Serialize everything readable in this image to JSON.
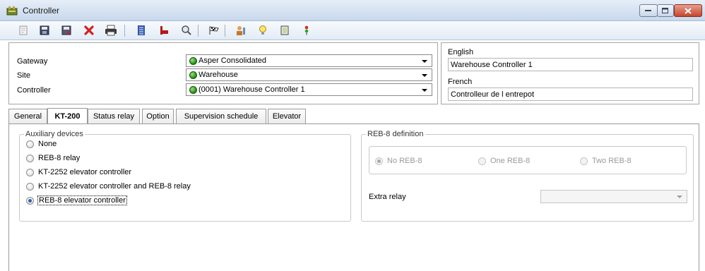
{
  "window": {
    "title": "Controller"
  },
  "toolbar": {
    "icons": [
      "new-icon",
      "save-icon",
      "save-close-icon",
      "delete-icon",
      "print-icon",
      "list-icon",
      "flag-red-icon",
      "search-icon",
      "checkered-flag-icon",
      "users-icon",
      "bulb-icon",
      "door-icon",
      "traffic-light-icon"
    ]
  },
  "header": {
    "gateway_label": "Gateway",
    "gateway_value": "Asper Consolidated",
    "site_label": "Site",
    "site_value": "Warehouse",
    "controller_label": "Controller",
    "controller_value": "(0001) Warehouse Controller 1"
  },
  "languages": {
    "english_label": "English",
    "english_value": "Warehouse Controller 1",
    "french_label": "French",
    "french_value": "Controlleur de l entrepot"
  },
  "tabs": [
    {
      "label": "General"
    },
    {
      "label": "KT-200"
    },
    {
      "label": "Status relay"
    },
    {
      "label": "Option"
    },
    {
      "label": "Supervision schedule"
    },
    {
      "label": "Elevator"
    }
  ],
  "auxiliary": {
    "title": "Auxiliary devices",
    "options": [
      {
        "label": "None"
      },
      {
        "label": "REB-8 relay"
      },
      {
        "label": "KT-2252 elevator controller"
      },
      {
        "label": "KT-2252 elevator controller and REB-8 relay"
      },
      {
        "label": "REB-8 elevator controller"
      }
    ],
    "selected": "REB-8 elevator controller"
  },
  "reb8": {
    "title": "REB-8 definition",
    "options": [
      {
        "label": "No REB-8"
      },
      {
        "label": "One REB-8"
      },
      {
        "label": "Two REB-8"
      }
    ],
    "selected": "No REB-8",
    "extra_relay_label": "Extra relay",
    "extra_relay_value": ""
  },
  "colors": {
    "titlebar": "#c8d8ec",
    "close_button": "#c8452d",
    "status_dot": "#1e8a12",
    "selected_radio": "#2b5fb4"
  }
}
